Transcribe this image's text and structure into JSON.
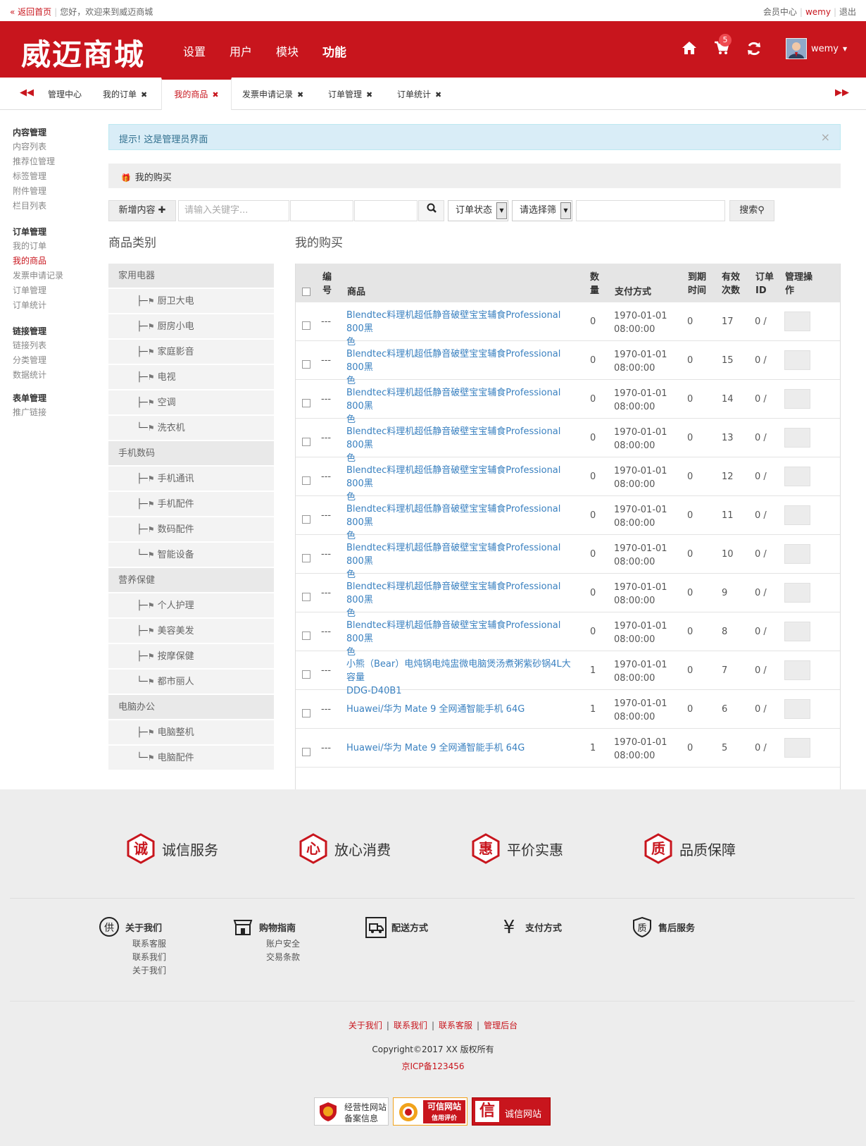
{
  "topbar": {
    "back_home": "« 返回首页",
    "welcome": "您好，欢迎来到威迈商城",
    "member_center": "会员中心",
    "username": "wemy",
    "logout": "退出"
  },
  "header": {
    "logo": "威迈商城",
    "nav": [
      "设置",
      "用户",
      "模块",
      "功能"
    ],
    "active_nav": "功能",
    "cart_count": "5",
    "user": "wemy",
    "icons": [
      "home-icon",
      "cart-icon",
      "refresh-icon"
    ]
  },
  "tabs": [
    {
      "label": "管理中心",
      "closable": false
    },
    {
      "label": "我的订单",
      "closable": true
    },
    {
      "label": "我的商品",
      "closable": true,
      "active": true
    },
    {
      "label": "发票申请记录",
      "closable": true
    },
    {
      "label": "订单管理",
      "closable": true
    },
    {
      "label": "订单统计",
      "closable": true
    }
  ],
  "sidebar": {
    "groups": [
      {
        "title": "内容管理",
        "items": [
          "内容列表",
          "推荐位管理",
          "标签管理",
          "附件管理",
          "栏目列表"
        ]
      },
      {
        "title": "订单管理",
        "items": [
          "我的订单",
          "我的商品",
          "发票申请记录",
          "订单管理",
          "订单统计"
        ],
        "active": "我的商品"
      },
      {
        "title": "链接管理",
        "items": [
          "链接列表",
          "分类管理",
          "数据统计"
        ]
      },
      {
        "title": "表单管理",
        "items": [
          "推广链接"
        ]
      }
    ]
  },
  "tip": {
    "label": "提示!",
    "text": "这是管理员界面",
    "close": "×"
  },
  "panel_title": "我的购买",
  "toolbar": {
    "add_button": "新增内容",
    "keyword_placeholder": "请输入关键字...",
    "order_status": "订单状态",
    "filter": "请选择筛",
    "search_button": "搜索"
  },
  "categories_title": "商品类别",
  "categories": [
    {
      "name": "家用电器",
      "children": [
        "厨卫大电",
        "厨房小电",
        "家庭影音",
        "电视",
        "空调",
        "洗衣机"
      ]
    },
    {
      "name": "手机数码",
      "children": [
        "手机通讯",
        "手机配件",
        "数码配件",
        "智能设备"
      ]
    },
    {
      "name": "营养保健",
      "children": [
        "个人护理",
        "美容美发",
        "按摩保健",
        "都市丽人"
      ]
    },
    {
      "name": "电脑办公",
      "children": [
        "电脑整机",
        "电脑配件"
      ]
    }
  ],
  "table_title": "我的购买",
  "table": {
    "headers": [
      "编号",
      "商品",
      "数量",
      "支付方式",
      "到期时间",
      "有效次数",
      "订单ID",
      "管理操作"
    ],
    "header_lines": {
      "id": [
        "编",
        "号"
      ],
      "qty": [
        "数",
        "量"
      ],
      "expire": [
        "到期",
        "时间"
      ],
      "valid": [
        "有效",
        "次数"
      ],
      "order": [
        "订单",
        "ID"
      ],
      "manage": [
        "管理操",
        "作"
      ]
    },
    "rows": [
      {
        "id": "---",
        "product": [
          "Blendtec料理机超低静音破壁宝宝辅食Professional 800黑",
          "色"
        ],
        "qty": "0",
        "pay": [
          "1970-01-01",
          "08:00:00"
        ],
        "expire": "0",
        "valid": "17",
        "order": "0 /"
      },
      {
        "id": "---",
        "product": [
          "Blendtec料理机超低静音破壁宝宝辅食Professional 800黑",
          "色"
        ],
        "qty": "0",
        "pay": [
          "1970-01-01",
          "08:00:00"
        ],
        "expire": "0",
        "valid": "15",
        "order": "0 /"
      },
      {
        "id": "---",
        "product": [
          "Blendtec料理机超低静音破壁宝宝辅食Professional 800黑",
          "色"
        ],
        "qty": "0",
        "pay": [
          "1970-01-01",
          "08:00:00"
        ],
        "expire": "0",
        "valid": "14",
        "order": "0 /"
      },
      {
        "id": "---",
        "product": [
          "Blendtec料理机超低静音破壁宝宝辅食Professional 800黑",
          "色"
        ],
        "qty": "0",
        "pay": [
          "1970-01-01",
          "08:00:00"
        ],
        "expire": "0",
        "valid": "13",
        "order": "0 /"
      },
      {
        "id": "---",
        "product": [
          "Blendtec料理机超低静音破壁宝宝辅食Professional 800黑",
          "色"
        ],
        "qty": "0",
        "pay": [
          "1970-01-01",
          "08:00:00"
        ],
        "expire": "0",
        "valid": "12",
        "order": "0 /"
      },
      {
        "id": "---",
        "product": [
          "Blendtec料理机超低静音破壁宝宝辅食Professional 800黑",
          "色"
        ],
        "qty": "0",
        "pay": [
          "1970-01-01",
          "08:00:00"
        ],
        "expire": "0",
        "valid": "11",
        "order": "0 /"
      },
      {
        "id": "---",
        "product": [
          "Blendtec料理机超低静音破壁宝宝辅食Professional 800黑",
          "色"
        ],
        "qty": "0",
        "pay": [
          "1970-01-01",
          "08:00:00"
        ],
        "expire": "0",
        "valid": "10",
        "order": "0 /"
      },
      {
        "id": "---",
        "product": [
          "Blendtec料理机超低静音破壁宝宝辅食Professional 800黑",
          "色"
        ],
        "qty": "0",
        "pay": [
          "1970-01-01",
          "08:00:00"
        ],
        "expire": "0",
        "valid": "9",
        "order": "0 /"
      },
      {
        "id": "---",
        "product": [
          "Blendtec料理机超低静音破壁宝宝辅食Professional 800黑",
          "色"
        ],
        "qty": "0",
        "pay": [
          "1970-01-01",
          "08:00:00"
        ],
        "expire": "0",
        "valid": "8",
        "order": "0 /"
      },
      {
        "id": "---",
        "product": [
          "小熊（Bear）电炖锅电炖盅微电脑煲汤煮粥紫砂锅4L大容量",
          "DDG-D40B1"
        ],
        "qty": "1",
        "pay": [
          "1970-01-01",
          "08:00:00"
        ],
        "expire": "0",
        "valid": "7",
        "order": "0 /"
      },
      {
        "id": "---",
        "product": [
          "Huawei/华为 Mate 9 全网通智能手机 64G",
          ""
        ],
        "qty": "1",
        "pay": [
          "1970-01-01",
          "08:00:00"
        ],
        "expire": "0",
        "valid": "6",
        "order": "0 /"
      },
      {
        "id": "---",
        "product": [
          "Huawei/华为 Mate 9 全网通智能手机 64G",
          ""
        ],
        "qty": "1",
        "pay": [
          "1970-01-01",
          "08:00:00"
        ],
        "expire": "0",
        "valid": "5",
        "order": "0 /"
      }
    ]
  },
  "footer": {
    "features": [
      {
        "char": "诚",
        "label": "诚信服务"
      },
      {
        "char": "心",
        "label": "放心消费"
      },
      {
        "char": "惠",
        "label": "平价实惠"
      },
      {
        "char": "质",
        "label": "品质保障"
      }
    ],
    "columns": [
      {
        "icon": "供",
        "title": "关于我们",
        "links": [
          "联系客服",
          "联系我们",
          "关于我们"
        ]
      },
      {
        "icon": "",
        "title": "购物指南",
        "links": [
          "账户安全",
          "交易条款"
        ]
      },
      {
        "icon": "",
        "title": "配送方式",
        "links": []
      },
      {
        "icon": "¥",
        "title": "支付方式",
        "links": []
      },
      {
        "icon": "质",
        "title": "售后服务",
        "links": []
      }
    ],
    "links": [
      "关于我们",
      "联系我们",
      "联系客服",
      "管理后台"
    ],
    "link_sep": "|",
    "copyright": "Copyright©2017 XX 版权所有",
    "icp": "京ICP备123456",
    "badges": [
      {
        "line1": "经营性网站",
        "line2": "备案信息"
      },
      {
        "line1": "可信网站",
        "line2": "信用评价"
      },
      {
        "line1": "诚信网站",
        "line2": ""
      }
    ]
  },
  "colors": {
    "brand": "#c8151d",
    "link": "#3a81c0",
    "tip_bg": "#d9edf7"
  }
}
